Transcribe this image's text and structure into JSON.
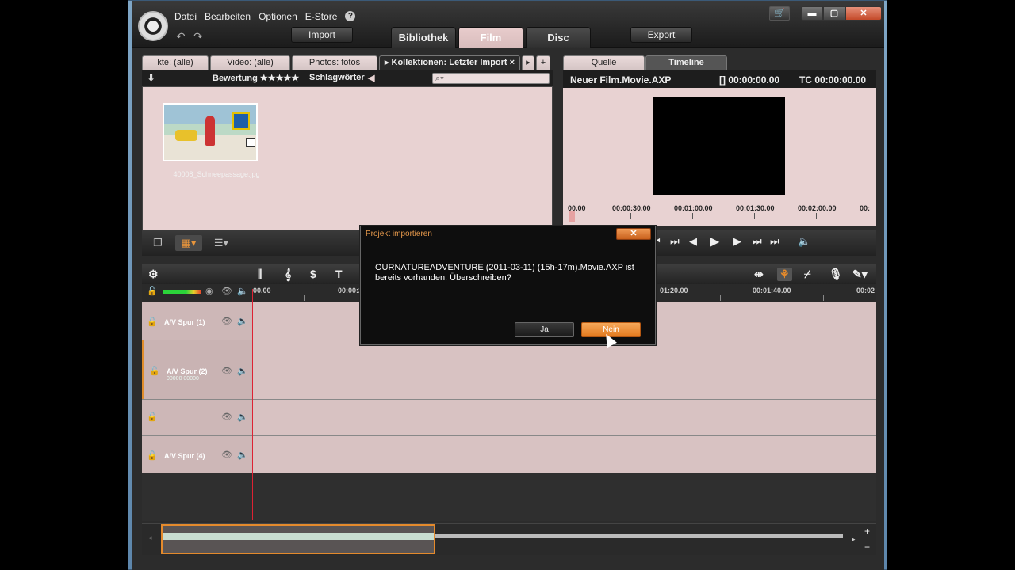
{
  "menu": {
    "items": [
      "Datei",
      "Bearbeiten",
      "Optionen",
      "E-Store"
    ],
    "help": "?"
  },
  "toolbar": {
    "import": "Import",
    "export": "Export"
  },
  "main_tabs": [
    "Bibliothek",
    "Film",
    "Disc"
  ],
  "window_controls": {
    "cart": "🛒",
    "min": "▬",
    "max": "▢",
    "close": "✕"
  },
  "library": {
    "tabs": [
      "kte: (alle)",
      "Video: (alle)",
      "Photos: fotos",
      "▸ Kollektionen: Letzter Import ×"
    ],
    "bar": {
      "rating_label": "Bewertung ★★★★★",
      "keywords_label": "Schlagwörter"
    },
    "thumb_caption": "40008_Schneepassage.jpg"
  },
  "player": {
    "tabs": [
      "Quelle",
      "Timeline"
    ],
    "project": "Neuer Film.Movie.AXP",
    "timecode_in": "[] 00:00:00.00",
    "timecode_tc": "TC 00:00:00.00",
    "ruler": [
      "00.00",
      "00:00:30.00",
      "00:01:00.00",
      "00:01:30.00",
      "00:02:00.00",
      "00:"
    ]
  },
  "timeline": {
    "ruler": [
      "00.00",
      "00:00:2",
      "01:20.00",
      "00:01:40.00",
      "00:02"
    ],
    "tracks": [
      {
        "name": "A/V Spur (1)",
        "sub": ""
      },
      {
        "name": "A/V Spur (2)",
        "sub": "00000 00000"
      },
      {
        "name": "",
        "sub": ""
      },
      {
        "name": "A/V Spur (4)",
        "sub": ""
      }
    ]
  },
  "dialog": {
    "title": "Projekt importieren",
    "message": "OURNATUREADVENTURE (2011-03-11) (15h-17m).Movie.AXP ist bereits vorhanden. Überschreiben?",
    "yes": "Ja",
    "no": "Nein"
  },
  "colors": {
    "accent": "#e48a2c",
    "pane": "#e8d2d2",
    "playhead": "#dd2233"
  }
}
